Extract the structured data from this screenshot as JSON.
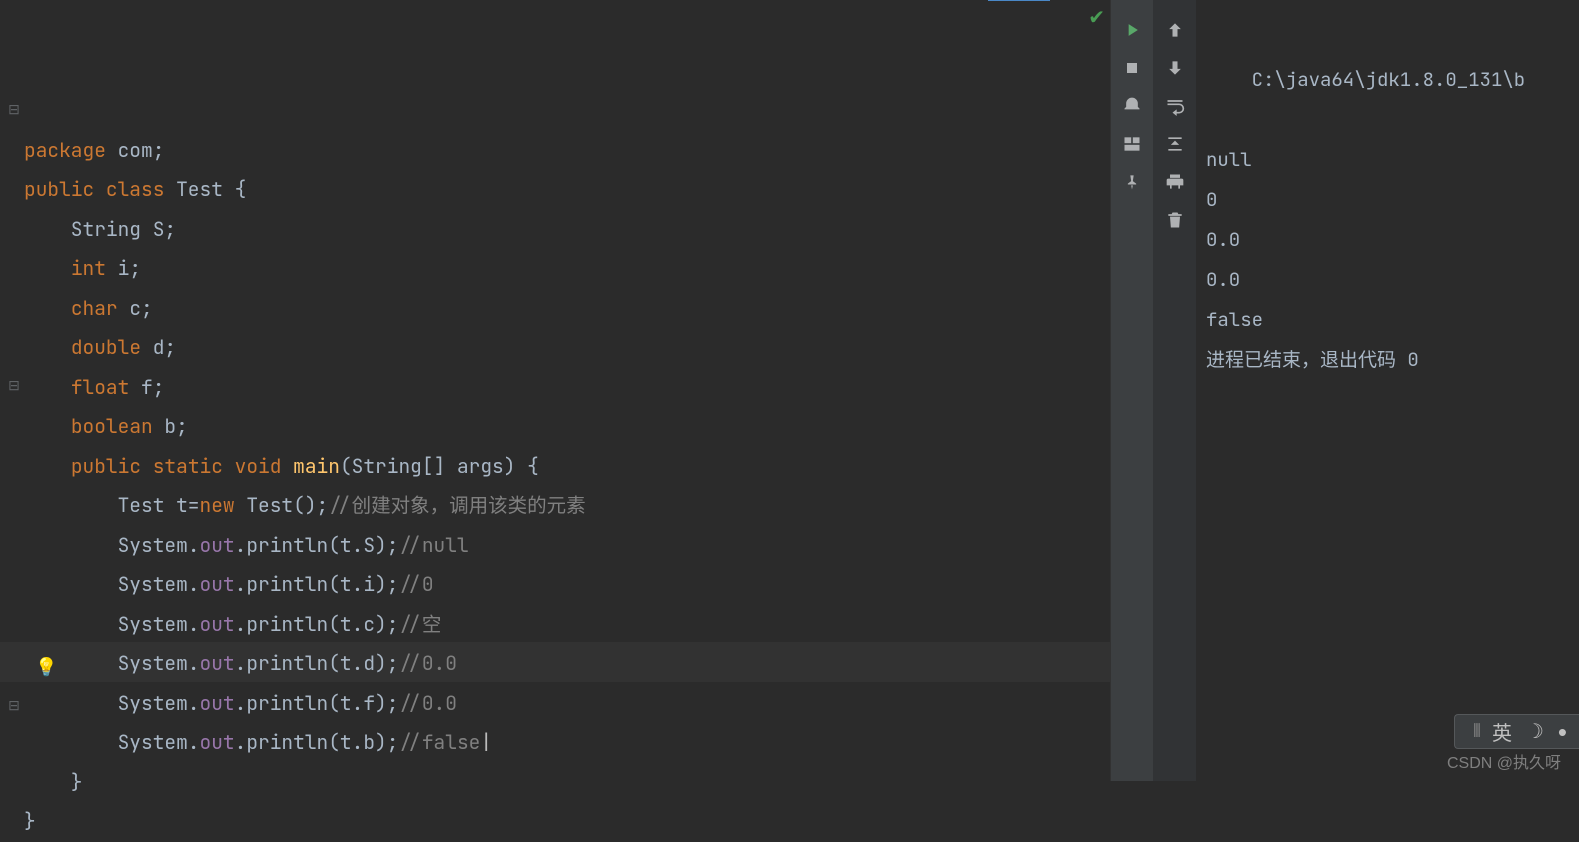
{
  "editor": {
    "lines": [
      {
        "tokens": [
          {
            "t": "package ",
            "c": "kw"
          },
          {
            "t": "com;",
            "c": ""
          }
        ]
      },
      {
        "tokens": [
          {
            "t": "",
            "c": ""
          }
        ]
      },
      {
        "tokens": [
          {
            "t": "public class ",
            "c": "kw"
          },
          {
            "t": "Test {",
            "c": ""
          }
        ]
      },
      {
        "tokens": [
          {
            "t": "    String S;",
            "c": ""
          }
        ]
      },
      {
        "tokens": [
          {
            "t": "    ",
            "c": ""
          },
          {
            "t": "int ",
            "c": "kw"
          },
          {
            "t": "i;",
            "c": ""
          }
        ]
      },
      {
        "tokens": [
          {
            "t": "    ",
            "c": ""
          },
          {
            "t": "char ",
            "c": "kw"
          },
          {
            "t": "c;",
            "c": ""
          }
        ]
      },
      {
        "tokens": [
          {
            "t": "    ",
            "c": ""
          },
          {
            "t": "double ",
            "c": "kw"
          },
          {
            "t": "d;",
            "c": ""
          }
        ]
      },
      {
        "tokens": [
          {
            "t": "    ",
            "c": ""
          },
          {
            "t": "float ",
            "c": "kw"
          },
          {
            "t": "f;",
            "c": ""
          }
        ]
      },
      {
        "tokens": [
          {
            "t": "    ",
            "c": ""
          },
          {
            "t": "boolean ",
            "c": "kw"
          },
          {
            "t": "b;",
            "c": ""
          }
        ]
      },
      {
        "tokens": [
          {
            "t": "    ",
            "c": ""
          },
          {
            "t": "public static void ",
            "c": "kw"
          },
          {
            "t": "main",
            "c": "fn"
          },
          {
            "t": "(String[] args) {",
            "c": ""
          }
        ]
      },
      {
        "tokens": [
          {
            "t": "        Test t=",
            "c": ""
          },
          {
            "t": "new ",
            "c": "kw"
          },
          {
            "t": "Test();",
            "c": ""
          },
          {
            "t": "//创建对象，调用该类的元素",
            "c": "com"
          }
        ]
      },
      {
        "tokens": [
          {
            "t": "        System.",
            "c": ""
          },
          {
            "t": "out",
            "c": "Sname"
          },
          {
            "t": ".println(t.S);",
            "c": ""
          },
          {
            "t": "//null",
            "c": "com"
          }
        ]
      },
      {
        "tokens": [
          {
            "t": "        System.",
            "c": ""
          },
          {
            "t": "out",
            "c": "Sname"
          },
          {
            "t": ".println(t.i);",
            "c": ""
          },
          {
            "t": "//0",
            "c": "com"
          }
        ]
      },
      {
        "tokens": [
          {
            "t": "        System.",
            "c": ""
          },
          {
            "t": "out",
            "c": "Sname"
          },
          {
            "t": ".println(t.c);",
            "c": ""
          },
          {
            "t": "//空",
            "c": "com"
          }
        ]
      },
      {
        "tokens": [
          {
            "t": "        System.",
            "c": ""
          },
          {
            "t": "out",
            "c": "Sname"
          },
          {
            "t": ".println(t.d);",
            "c": ""
          },
          {
            "t": "//0.0",
            "c": "com"
          }
        ]
      },
      {
        "tokens": [
          {
            "t": "        System.",
            "c": ""
          },
          {
            "t": "out",
            "c": "Sname"
          },
          {
            "t": ".println(t.f);",
            "c": ""
          },
          {
            "t": "//0.0",
            "c": "com"
          }
        ]
      },
      {
        "tokens": [
          {
            "t": "        System.",
            "c": ""
          },
          {
            "t": "out",
            "c": "Sname"
          },
          {
            "t": ".println(t.b);",
            "c": ""
          },
          {
            "t": "//false",
            "c": "com"
          }
        ],
        "cursor": true
      },
      {
        "tokens": [
          {
            "t": "    }",
            "c": ""
          }
        ]
      },
      {
        "tokens": [
          {
            "t": "}",
            "c": ""
          }
        ]
      }
    ],
    "active_line_index": 16
  },
  "console": {
    "path": "C:\\java64\\jdk1.8.0_131\\b",
    "output": [
      "null",
      "0",
      "",
      "0.0",
      "0.0",
      "false",
      "",
      "进程已结束，退出代码 0"
    ]
  },
  "toolbar1": {
    "icons": [
      "run",
      "up",
      "stop",
      "down",
      "debug",
      "wrap",
      "layout",
      "scroll",
      "pin",
      "print",
      "",
      "trash"
    ]
  },
  "ime": {
    "lang": "英"
  },
  "watermark": "CSDN @执久呀"
}
